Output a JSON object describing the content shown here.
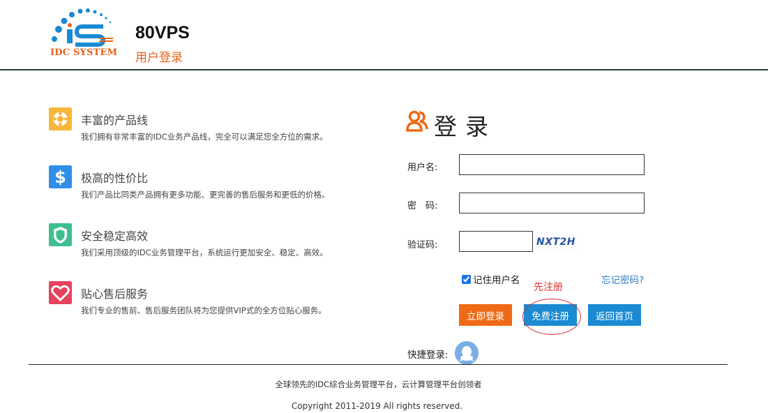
{
  "header": {
    "logo_text": "IDC SYSTEM",
    "site_name": "80VPS",
    "subtitle": "用户登录"
  },
  "features": [
    {
      "icon": "lifebuoy-icon",
      "title": "丰富的产品线",
      "desc": "我们拥有非常丰富的IDC业务产品线，完全可以满足您全方位的需求。",
      "color": "#f6b73c"
    },
    {
      "icon": "dollar-icon",
      "title": "极高的性价比",
      "desc": "我们产品比同类产品拥有更多功能、更完善的售后服务和更低的价格。",
      "color": "#2e8ee8"
    },
    {
      "icon": "shield-icon",
      "title": "安全稳定高效",
      "desc": "我们采用顶级的IDC业务管理平台，系统运行更加安全、稳定、高效。",
      "color": "#3dbf8f"
    },
    {
      "icon": "heart-icon",
      "title": "贴心售后服务",
      "desc": "我们专业的售前、售后服务团队将为您提供VIP式的全方位贴心服务。",
      "color": "#e8415d"
    }
  ],
  "login": {
    "title": "登录",
    "username_label": "用户名:",
    "username_value": "",
    "password_label": "密　码:",
    "password_value": "",
    "captcha_label": "验证码:",
    "captcha_value": "",
    "captcha_image_text": "NXT2H",
    "remember_label": "记住用户名",
    "remember_checked": true,
    "forgot_link": "忘记密码?",
    "annotation": "先注册",
    "btn_login": "立即登录",
    "btn_register": "免费注册",
    "btn_home": "返回首页",
    "quick_login_label": "快捷登录:"
  },
  "footer": {
    "tagline": "全球领先的IDC综合业务管理平台，云计算管理平台创领者",
    "copyright": "Copyright 2011-2019 All rights reserved."
  },
  "colors": {
    "accent_orange": "#ef6a16",
    "accent_blue": "#1a8ad2",
    "annotation_red": "#e8302e"
  }
}
